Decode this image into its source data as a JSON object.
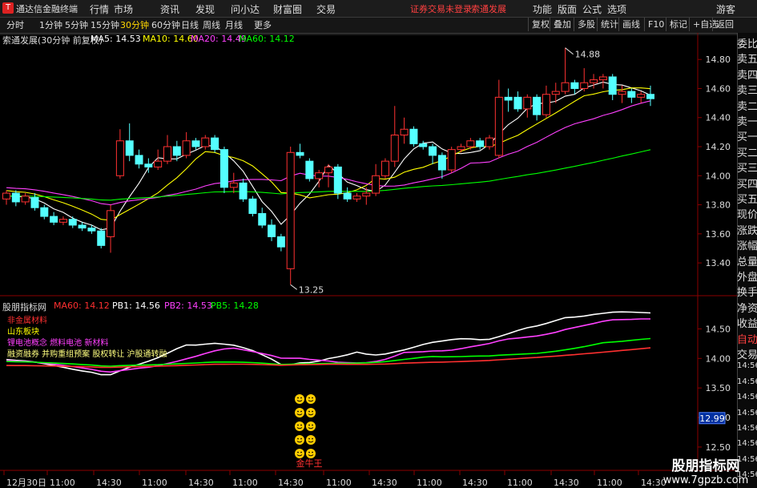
{
  "window": {
    "app_name": "通达信金融终端",
    "menu": [
      "行情",
      "市场",
      "资讯",
      "发现",
      "问小达",
      "财富圈",
      "交易"
    ],
    "status_links": [
      "证券交易未登录",
      "索通发展"
    ],
    "right_menu": [
      "功能",
      "版面",
      "公式",
      "选项"
    ],
    "user": "游客"
  },
  "periods": [
    "分时",
    "1分钟",
    "5分钟",
    "15分钟",
    "30分钟",
    "60分钟",
    "日线",
    "周线",
    "月线",
    "更多"
  ],
  "active_period": "30分钟",
  "toolbar_right": [
    "复权",
    "叠加",
    "多股",
    "统计",
    "画线",
    "F10",
    "标记",
    "+自选",
    "返回"
  ],
  "main_chart": {
    "title": "索通发展(30分钟 前复权)",
    "ma_labels": [
      {
        "text": "MA5: 14.53",
        "color": "#ffffff"
      },
      {
        "text": "MA10: 14.60",
        "color": "#ffff00"
      },
      {
        "text": "MA20: 14.49",
        "color": "#ff40ff"
      },
      {
        "text": "MA60: 14.12",
        "color": "#00ff00"
      }
    ],
    "y_ticks": [
      "14.80",
      "14.60",
      "14.40",
      "14.20",
      "14.00",
      "13.80",
      "13.60",
      "13.40"
    ],
    "high_label": "14.88",
    "low_label": "13.25"
  },
  "indicator": {
    "name": "股朋指标网",
    "labels": [
      {
        "text": "MA60: 14.12",
        "color": "#ff3030"
      },
      {
        "text": "PB1: 14.56",
        "color": "#ffffff"
      },
      {
        "text": "PB2: 14.53",
        "color": "#ff40ff"
      },
      {
        "text": "PB5: 14.28",
        "color": "#00ff00"
      }
    ],
    "concepts": [
      {
        "text": "非金属材料",
        "color": "#ff3030"
      },
      {
        "text": "山东板块",
        "color": "#ffff00"
      },
      {
        "text": "锂电池概念 燃料电池 新材料",
        "color": "#ff40ff"
      },
      {
        "text": "融资融券 并购重组预案 股权转让 沪股通转融",
        "color": "#ffff80"
      }
    ],
    "y_ticks": [
      "14.50",
      "14.00",
      "13.50",
      "13.00",
      "12.50"
    ],
    "current_value": "12.99",
    "bottom_label": "金牛王"
  },
  "time_axis": [
    "12月30日",
    "11:00",
    "14:30",
    "11:00",
    "14:30",
    "11:00",
    "14:30",
    "11:00",
    "14:30",
    "11:00",
    "14:30",
    "11:00",
    "14:30",
    "11:00",
    "14:30"
  ],
  "side_labels": [
    "委比",
    "卖五",
    "卖四",
    "卖三",
    "卖二",
    "卖一",
    "买一",
    "买二",
    "买三",
    "买四",
    "买五",
    "现价",
    "涨跌",
    "涨幅",
    "总量",
    "外盘",
    "换手",
    "净资",
    "收益",
    "自动",
    "交易",
    "14:56",
    "14:56",
    "14:56",
    "14:56",
    "14:56",
    "14:56",
    "14:56",
    "14:56"
  ],
  "watermark": {
    "line1": "股朋指标网",
    "line2": "www.7gpzb.com"
  },
  "candles": [
    {
      "o": 13.84,
      "c": 13.88,
      "h": 13.9,
      "l": 13.8
    },
    {
      "o": 13.88,
      "c": 13.82,
      "h": 13.9,
      "l": 13.79
    },
    {
      "o": 13.82,
      "c": 13.86,
      "h": 13.88,
      "l": 13.8
    },
    {
      "o": 13.85,
      "c": 13.78,
      "h": 13.88,
      "l": 13.76
    },
    {
      "o": 13.78,
      "c": 13.72,
      "h": 13.8,
      "l": 13.7
    },
    {
      "o": 13.72,
      "c": 13.68,
      "h": 13.75,
      "l": 13.66
    },
    {
      "o": 13.68,
      "c": 13.7,
      "h": 13.72,
      "l": 13.66
    },
    {
      "o": 13.7,
      "c": 13.66,
      "h": 13.72,
      "l": 13.64
    },
    {
      "o": 13.66,
      "c": 13.64,
      "h": 13.68,
      "l": 13.62
    },
    {
      "o": 13.64,
      "c": 13.62,
      "h": 13.66,
      "l": 13.6
    },
    {
      "o": 13.62,
      "c": 13.52,
      "h": 13.64,
      "l": 13.5
    },
    {
      "o": 13.58,
      "c": 13.76,
      "h": 13.8,
      "l": 13.47
    },
    {
      "o": 14.0,
      "c": 14.24,
      "h": 14.32,
      "l": 13.98
    },
    {
      "o": 14.24,
      "c": 14.14,
      "h": 14.36,
      "l": 14.1
    },
    {
      "o": 14.14,
      "c": 14.08,
      "h": 14.18,
      "l": 14.05
    },
    {
      "o": 14.08,
      "c": 14.06,
      "h": 14.12,
      "l": 14.02
    },
    {
      "o": 14.06,
      "c": 14.1,
      "h": 14.18,
      "l": 14.04
    },
    {
      "o": 14.1,
      "c": 14.2,
      "h": 14.28,
      "l": 14.08
    },
    {
      "o": 14.2,
      "c": 14.14,
      "h": 14.24,
      "l": 14.1
    },
    {
      "o": 14.14,
      "c": 14.24,
      "h": 14.3,
      "l": 14.12
    },
    {
      "o": 14.24,
      "c": 14.2,
      "h": 14.26,
      "l": 14.18
    },
    {
      "o": 14.2,
      "c": 14.26,
      "h": 14.28,
      "l": 14.18
    },
    {
      "o": 14.26,
      "c": 14.18,
      "h": 14.28,
      "l": 14.16
    },
    {
      "o": 14.18,
      "c": 13.92,
      "h": 14.2,
      "l": 13.88
    },
    {
      "o": 13.92,
      "c": 13.95,
      "h": 14.02,
      "l": 13.88
    },
    {
      "o": 13.95,
      "c": 13.84,
      "h": 13.98,
      "l": 13.82
    },
    {
      "o": 13.84,
      "c": 13.74,
      "h": 13.86,
      "l": 13.72
    },
    {
      "o": 13.74,
      "c": 13.66,
      "h": 13.78,
      "l": 13.64
    },
    {
      "o": 13.66,
      "c": 13.58,
      "h": 13.7,
      "l": 13.55
    },
    {
      "o": 13.58,
      "c": 13.51,
      "h": 13.6,
      "l": 13.48
    },
    {
      "o": 13.36,
      "c": 14.16,
      "h": 14.2,
      "l": 13.25
    },
    {
      "o": 14.16,
      "c": 14.14,
      "h": 14.22,
      "l": 14.12
    },
    {
      "o": 14.1,
      "c": 13.98,
      "h": 14.12,
      "l": 13.96
    },
    {
      "o": 13.98,
      "c": 14.02,
      "h": 14.04,
      "l": 13.92
    },
    {
      "o": 14.02,
      "c": 14.06,
      "h": 14.08,
      "l": 13.92
    },
    {
      "o": 14.06,
      "c": 13.88,
      "h": 14.08,
      "l": 13.84
    },
    {
      "o": 13.88,
      "c": 13.84,
      "h": 13.92,
      "l": 13.82
    },
    {
      "o": 13.84,
      "c": 13.86,
      "h": 13.88,
      "l": 13.82
    },
    {
      "o": 13.86,
      "c": 13.88,
      "h": 13.92,
      "l": 13.8
    },
    {
      "o": 13.88,
      "c": 14.0,
      "h": 14.08,
      "l": 13.86
    },
    {
      "o": 14.0,
      "c": 14.1,
      "h": 14.12,
      "l": 13.98
    },
    {
      "o": 14.1,
      "c": 14.28,
      "h": 14.48,
      "l": 14.06
    },
    {
      "o": 14.28,
      "c": 14.32,
      "h": 14.4,
      "l": 14.22
    },
    {
      "o": 14.32,
      "c": 14.22,
      "h": 14.34,
      "l": 14.2
    },
    {
      "o": 14.22,
      "c": 14.2,
      "h": 14.24,
      "l": 14.18
    },
    {
      "o": 14.2,
      "c": 14.14,
      "h": 14.22,
      "l": 14.08
    },
    {
      "o": 14.14,
      "c": 14.04,
      "h": 14.16,
      "l": 13.98
    },
    {
      "o": 14.04,
      "c": 14.18,
      "h": 14.2,
      "l": 14.02
    },
    {
      "o": 14.18,
      "c": 14.2,
      "h": 14.22,
      "l": 14.16
    },
    {
      "o": 14.2,
      "c": 14.24,
      "h": 14.26,
      "l": 14.18
    },
    {
      "o": 14.24,
      "c": 14.2,
      "h": 14.26,
      "l": 14.18
    },
    {
      "o": 14.2,
      "c": 14.26,
      "h": 14.28,
      "l": 14.18
    },
    {
      "o": 14.14,
      "c": 14.54,
      "h": 14.66,
      "l": 14.12
    },
    {
      "o": 14.54,
      "c": 14.52,
      "h": 14.6,
      "l": 14.44
    },
    {
      "o": 14.54,
      "c": 14.46,
      "h": 14.58,
      "l": 14.44
    },
    {
      "o": 14.46,
      "c": 14.54,
      "h": 14.56,
      "l": 14.4
    },
    {
      "o": 14.54,
      "c": 14.42,
      "h": 14.56,
      "l": 14.38
    },
    {
      "o": 14.42,
      "c": 14.56,
      "h": 14.62,
      "l": 14.4
    },
    {
      "o": 14.56,
      "c": 14.58,
      "h": 14.64,
      "l": 14.5
    },
    {
      "o": 14.58,
      "c": 14.64,
      "h": 14.88,
      "l": 14.56
    },
    {
      "o": 14.64,
      "c": 14.6,
      "h": 14.66,
      "l": 14.56
    },
    {
      "o": 14.6,
      "c": 14.64,
      "h": 14.74,
      "l": 14.58
    },
    {
      "o": 14.64,
      "c": 14.66,
      "h": 14.7,
      "l": 14.6
    },
    {
      "o": 14.66,
      "c": 14.68,
      "h": 14.7,
      "l": 14.6
    },
    {
      "o": 14.68,
      "c": 14.56,
      "h": 14.7,
      "l": 14.52
    },
    {
      "o": 14.56,
      "c": 14.58,
      "h": 14.62,
      "l": 14.5
    },
    {
      "o": 14.58,
      "c": 14.54,
      "h": 14.6,
      "l": 14.5
    },
    {
      "o": 14.54,
      "c": 14.56,
      "h": 14.58,
      "l": 14.5
    },
    {
      "o": 14.56,
      "c": 14.53,
      "h": 14.62,
      "l": 14.48
    }
  ]
}
